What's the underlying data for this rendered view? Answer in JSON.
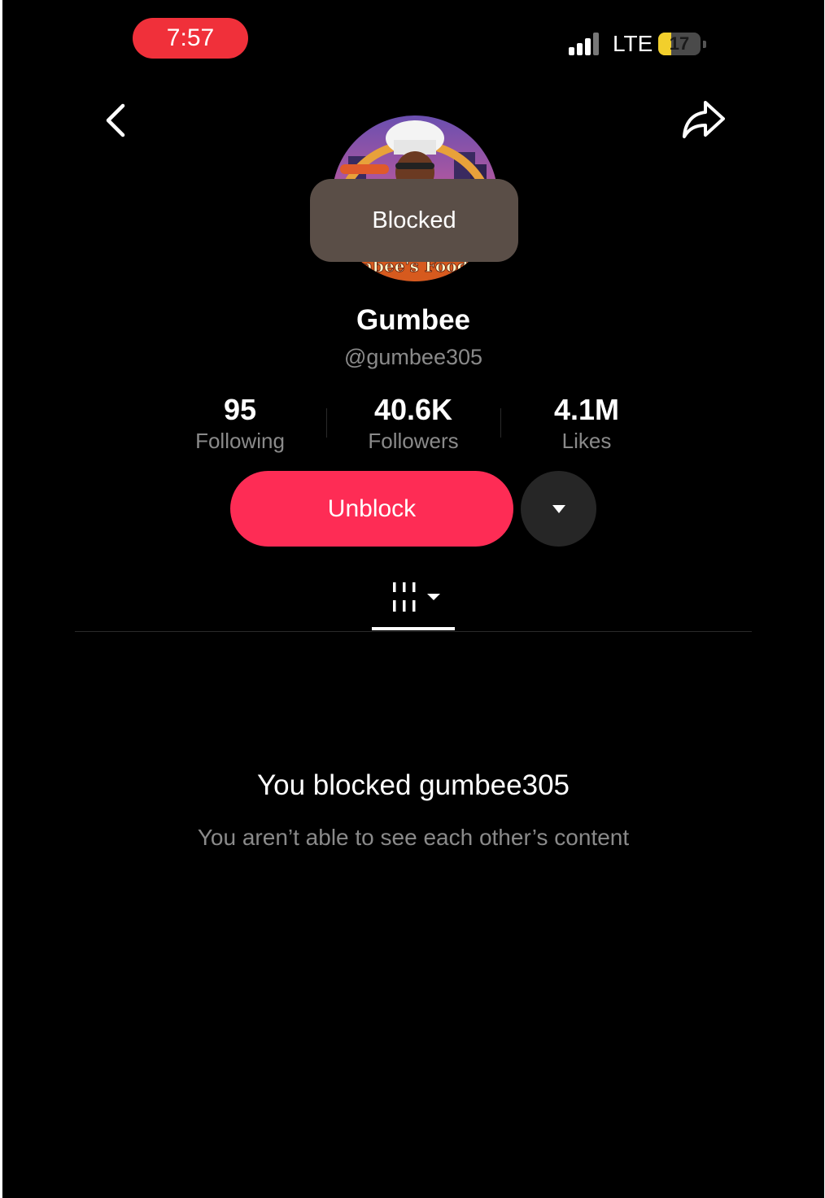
{
  "status_bar": {
    "time": "7:57",
    "network": "LTE",
    "battery_level": "17",
    "battery_fraction": 0.17,
    "accent": "#f0303a"
  },
  "nav": {
    "back_icon": "chevron-left-icon",
    "share_icon": "share-arrow-icon"
  },
  "profile": {
    "avatar_text": "Gumbee's Food Ho",
    "toast": "Blocked",
    "name": "Gumbee",
    "handle": "@gumbee305"
  },
  "stats": [
    {
      "value": "95",
      "label": "Following"
    },
    {
      "value": "40.6K",
      "label": "Followers"
    },
    {
      "value": "4.1M",
      "label": "Likes"
    }
  ],
  "actions": {
    "unblock_label": "Unblock",
    "unblock_color": "#fe2c55",
    "more_icon": "caret-down-icon"
  },
  "tabs": {
    "videos_icon": "grid-filter-icon"
  },
  "blocked_message": {
    "title": "You blocked gumbee305",
    "subtitle": "You aren’t able to see each other’s content"
  }
}
